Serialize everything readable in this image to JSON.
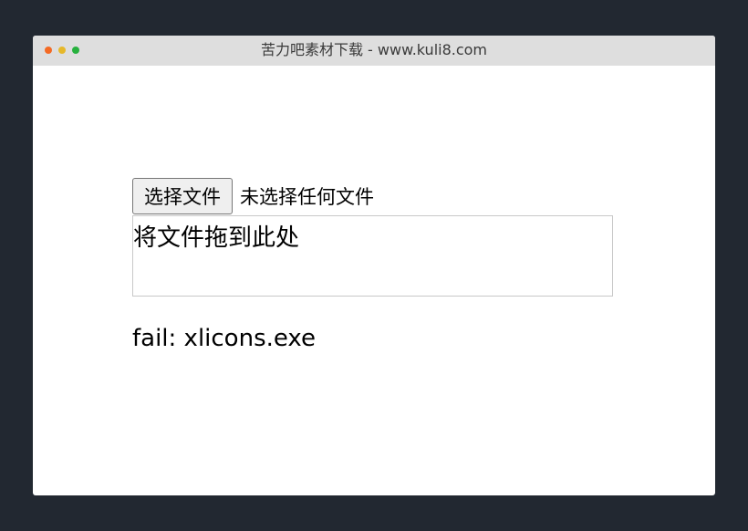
{
  "window": {
    "title": "苦力吧素材下载 - www.kuli8.com",
    "dot_colors": {
      "close": "#f46a24",
      "minimize": "#e6b82a",
      "maximize": "#27b13e"
    }
  },
  "uploader": {
    "button_label": "选择文件",
    "status_text": "未选择任何文件"
  },
  "dropzone": {
    "label": "将文件拖到此处"
  },
  "result": {
    "message": "fail: xlicons.exe"
  }
}
